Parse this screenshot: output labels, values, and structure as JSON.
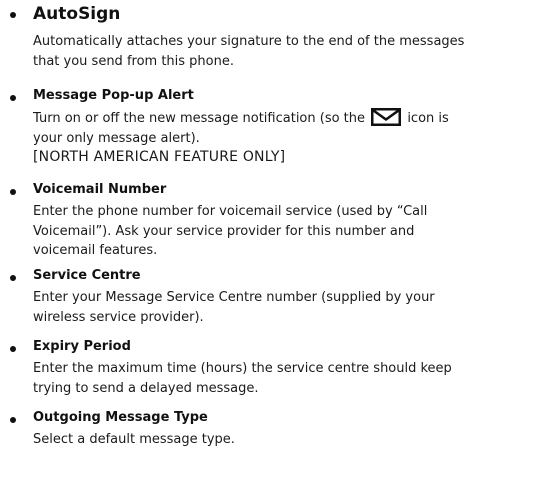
{
  "settings": [
    {
      "title": "AutoSign",
      "lines": [
        "Automatically attaches your signature to the end of the messages",
        "that you send from this phone."
      ]
    },
    {
      "title": "Message Pop-up Alert",
      "line1_before_icon": "Turn on or off the new message notification (so the",
      "line1_after_icon": "icon is",
      "line2": "your only message alert).",
      "icon": "envelope-icon",
      "note": "[NORTH AMERICAN FEATURE ONLY]"
    },
    {
      "title": "Voicemail Number",
      "lines": [
        "Enter the phone number for voicemail service (used by “Call",
        "Voicemail”). Ask your service provider for this number and",
        "voicemail features."
      ]
    },
    {
      "title": "Service Centre",
      "lines": [
        "Enter your Message Service Centre number (supplied by your",
        "wireless service provider)."
      ]
    },
    {
      "title": "Expiry Period",
      "lines": [
        "Enter the maximum time (hours) the service centre should keep",
        "trying to send a delayed message."
      ]
    },
    {
      "title": "Outgoing Message Type",
      "lines": [
        "Select a default message type."
      ]
    }
  ]
}
